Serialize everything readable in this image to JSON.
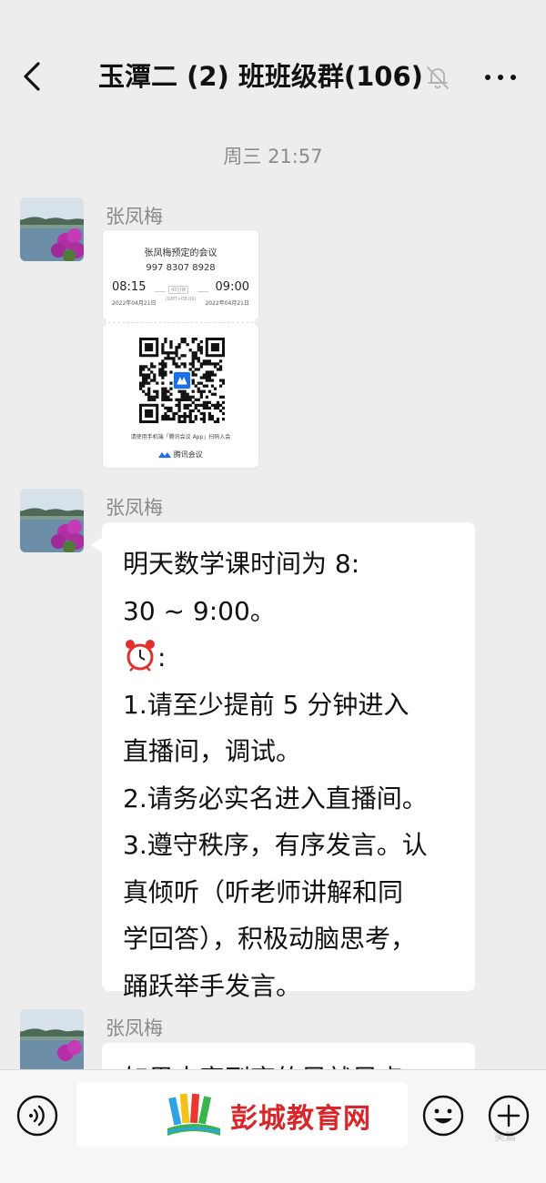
{
  "header": {
    "title": "玉潭二 (2) 班班级群(106)",
    "icons": [
      "back-icon",
      "mute-bell-icon",
      "more-icon"
    ]
  },
  "timestamp": "周三 21:57",
  "messages": [
    {
      "sender": "张凤梅",
      "type": "meeting-card",
      "card": {
        "title": "张凤梅预定的会议",
        "meeting_id": "997 8307 8928",
        "start_time": "08:15",
        "end_time": "09:00",
        "duration": "45分钟",
        "start_date": "2022年04月21日",
        "end_date": "2022年04月21日",
        "timezone": "(GMT+08:00)",
        "hint": "请使用手机端「腾讯会议 App」扫码入会",
        "brand": "腾讯会议"
      }
    },
    {
      "sender": "张凤梅",
      "type": "text",
      "lines": [
        "明天数学课时间为 8:",
        "30 ~ 9:00。",
        "⏰:",
        "1.请至少提前 5 分钟进入",
        "直播间，调试。",
        "2.请务必实名进入直播间。",
        "3.遵守秩序，有序发言。认",
        "真倾听（听老师讲解和同",
        "学回答），积极动脑思考，",
        "踊跃举手发言。"
      ]
    },
    {
      "sender": "张凤梅",
      "type": "text",
      "partial": "如果大家到齐的早就早点"
    }
  ],
  "bottom_bar": {
    "icons": [
      "voice-icon",
      "emoji-icon",
      "plus-icon"
    ]
  },
  "watermark": {
    "text": "彭城教育网",
    "corner": "美篇"
  },
  "colors": {
    "background": "#ededed",
    "bubble": "#ffffff",
    "watermark_red": "#d9262a"
  }
}
